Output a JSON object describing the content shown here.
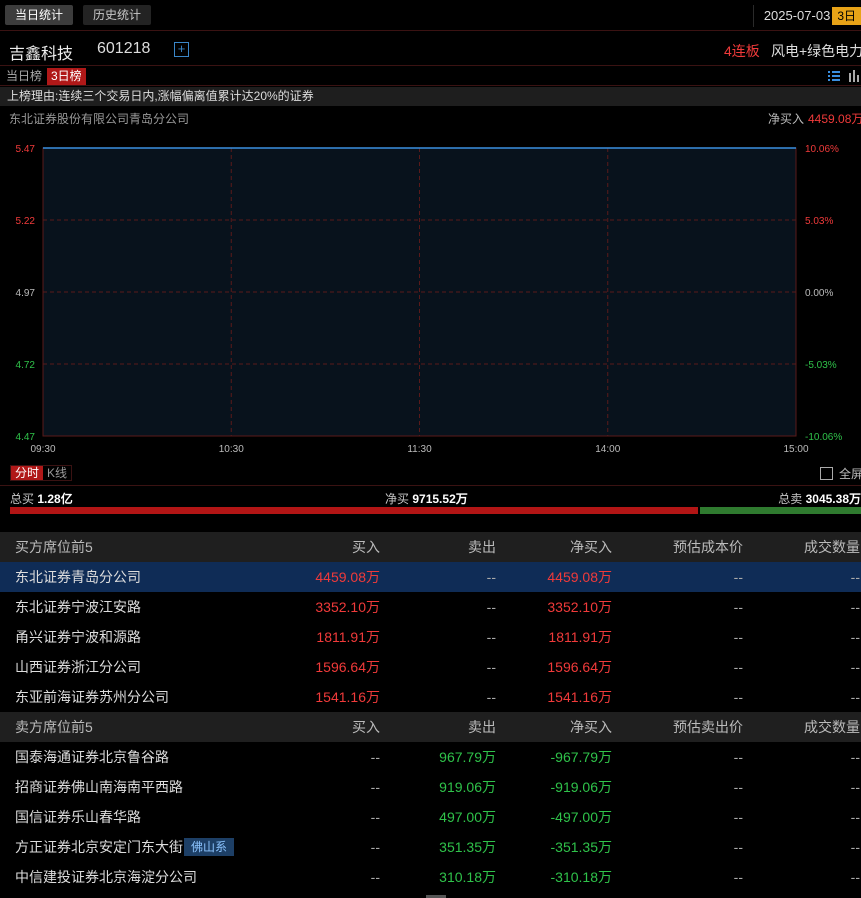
{
  "top_tabs": [
    {
      "label": "当日统计",
      "active": true
    },
    {
      "label": "历史统计",
      "active": false
    }
  ],
  "date": {
    "value": "2025-07-03",
    "badge": "3日"
  },
  "stock": {
    "name": "吉鑫科技",
    "code": "601218",
    "add_label": "+",
    "streak": "4连板",
    "concept": "风电+绿色电力"
  },
  "rank_tabs": [
    {
      "label": "当日榜",
      "active": false
    },
    {
      "label": "3日榜",
      "active": true
    }
  ],
  "reason": "上榜理由:连续三个交易日内,涨幅偏离值累计达20%的证券",
  "broker_line": {
    "name": "东北证券股份有限公司青岛分公司",
    "net_label": "净买入",
    "net_value": "4459.08万"
  },
  "chart_data": {
    "type": "line",
    "x_ticks": [
      "09:30",
      "10:30",
      "11:30",
      "14:00",
      "15:00"
    ],
    "y_ticks_left": [
      "5.47",
      "5.22",
      "4.97",
      "4.72",
      "4.47"
    ],
    "y_ticks_right": [
      "10.06%",
      "5.03%",
      "0.00%",
      "-5.03%",
      "-10.06%"
    ],
    "ylim": [
      4.47,
      5.47
    ],
    "series": [
      {
        "x": [
          "09:30",
          "15:00"
        ],
        "values": [
          5.47,
          5.47
        ]
      }
    ],
    "colors": {
      "line": "#3a8fe0",
      "grid": "#5a1a1a",
      "up": "#f03a3a",
      "down": "#2fc24a",
      "flat": "#bbbbbb"
    }
  },
  "chart_tabs": [
    {
      "label": "分时",
      "active": true
    },
    {
      "label": "K线",
      "active": false
    }
  ],
  "fullscreen_label": "全屏",
  "summary": {
    "total_buy_label": "总买",
    "total_buy": "1.28亿",
    "net_buy_label": "净买",
    "net_buy": "9715.52万",
    "total_sell_label": "总卖",
    "total_sell": "3045.38万",
    "buy_ratio": 0.808
  },
  "buy_table": {
    "headers": [
      "买方席位前5",
      "买入",
      "卖出",
      "净买入",
      "预估成本价",
      "成交数量"
    ],
    "rows": [
      {
        "name": "东北证券青岛分公司",
        "buy": "4459.08万",
        "sell": "--",
        "net": "4459.08万",
        "cost": "--",
        "qty": "--",
        "selected": true
      },
      {
        "name": "东北证券宁波江安路",
        "buy": "3352.10万",
        "sell": "--",
        "net": "3352.10万",
        "cost": "--",
        "qty": "--"
      },
      {
        "name": "甬兴证券宁波和源路",
        "buy": "1811.91万",
        "sell": "--",
        "net": "1811.91万",
        "cost": "--",
        "qty": "--"
      },
      {
        "name": "山西证券浙江分公司",
        "buy": "1596.64万",
        "sell": "--",
        "net": "1596.64万",
        "cost": "--",
        "qty": "--"
      },
      {
        "name": "东亚前海证券苏州分公司",
        "buy": "1541.16万",
        "sell": "--",
        "net": "1541.16万",
        "cost": "--",
        "qty": "--"
      }
    ]
  },
  "sell_table": {
    "headers": [
      "卖方席位前5",
      "买入",
      "卖出",
      "净买入",
      "预估卖出价",
      "成交数量"
    ],
    "rows": [
      {
        "name": "国泰海通证券北京鲁谷路",
        "buy": "--",
        "sell": "967.79万",
        "net": "-967.79万",
        "cost": "--",
        "qty": "--"
      },
      {
        "name": "招商证券佛山南海南平西路",
        "buy": "--",
        "sell": "919.06万",
        "net": "-919.06万",
        "cost": "--",
        "qty": "--"
      },
      {
        "name": "国信证券乐山春华路",
        "buy": "--",
        "sell": "497.00万",
        "net": "-497.00万",
        "cost": "--",
        "qty": "--"
      },
      {
        "name": "方正证券北京安定门东大街",
        "tag": "佛山系",
        "buy": "--",
        "sell": "351.35万",
        "net": "-351.35万",
        "cost": "--",
        "qty": "--"
      },
      {
        "name": "中信建投证券北京海淀分公司",
        "buy": "--",
        "sell": "310.18万",
        "net": "-310.18万",
        "cost": "--",
        "qty": "--"
      }
    ]
  }
}
